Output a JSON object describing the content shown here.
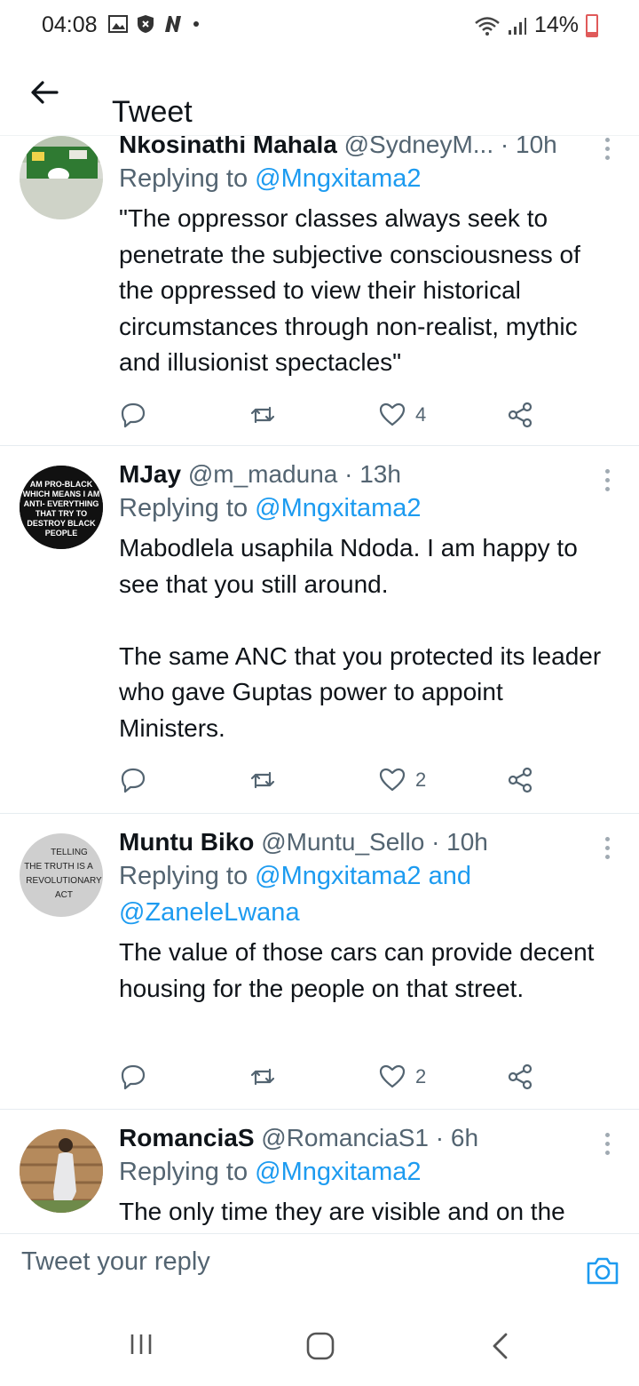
{
  "status_bar": {
    "time": "04:08",
    "battery": "14%",
    "icons_left": [
      "gallery-icon",
      "shield-icon",
      "n-app-icon",
      "dot-icon"
    ],
    "icons_right": [
      "wifi-icon",
      "signal-icon",
      "battery-icon"
    ]
  },
  "header": {
    "title": "Tweet",
    "back_icon": "arrow-left-icon"
  },
  "tweets": [
    {
      "name": "Nkosinathi Mahala",
      "handle": "@SydneyM...",
      "time": "· 10h",
      "replying_prefix": "Replying to ",
      "replying_to": "@Mngxitama2",
      "replying_extra": "",
      "text": "\"The oppressor classes always seek to penetrate the subjective consciousness of the oppressed to view their historical circumstances through non-realist, mythic and illusionist spectacles\"",
      "likes": "4",
      "avatar_text": ""
    },
    {
      "name": "MJay",
      "handle": "@m_maduna",
      "time": "· 13h",
      "replying_prefix": "Replying to ",
      "replying_to": "@Mngxitama2",
      "replying_extra": "",
      "text": "Mabodlela usaphila Ndoda. I am happy to see that you still around.\n\nThe same ANC that you protected its leader who gave Guptas power to appoint Ministers.",
      "likes": "2",
      "avatar_text": "AM PRO-BLACK WHICH MEANS I AM ANTI- EVERYTHING THAT TRY TO DESTROY BLACK PEOPLE"
    },
    {
      "name": "Muntu Biko",
      "handle": "@Muntu_Sello",
      "time": "· 10h",
      "replying_prefix": "Replying to ",
      "replying_to": "@Mngxitama2 and",
      "replying_extra": "@ZaneleLwana",
      "text": "The value of those cars can provide decent housing for the people on that street.",
      "likes": "2",
      "avatar_text": "TELLING THE TRUTH IS A REVOLUTIONARY ACT"
    },
    {
      "name": "RomanciaS",
      "handle": "@RomanciaS1",
      "time": "· 6h",
      "replying_prefix": "Replying to ",
      "replying_to": "@Mngxitama2",
      "replying_extra": "",
      "text": "The only time they are visible and on the",
      "likes": "",
      "avatar_text": ""
    }
  ],
  "reply_bar": {
    "placeholder": "Tweet your reply",
    "camera_icon": "camera-icon"
  },
  "colors": {
    "accent": "#1d9bf0",
    "secondary_text": "#536471",
    "primary_text": "#0f1419"
  }
}
